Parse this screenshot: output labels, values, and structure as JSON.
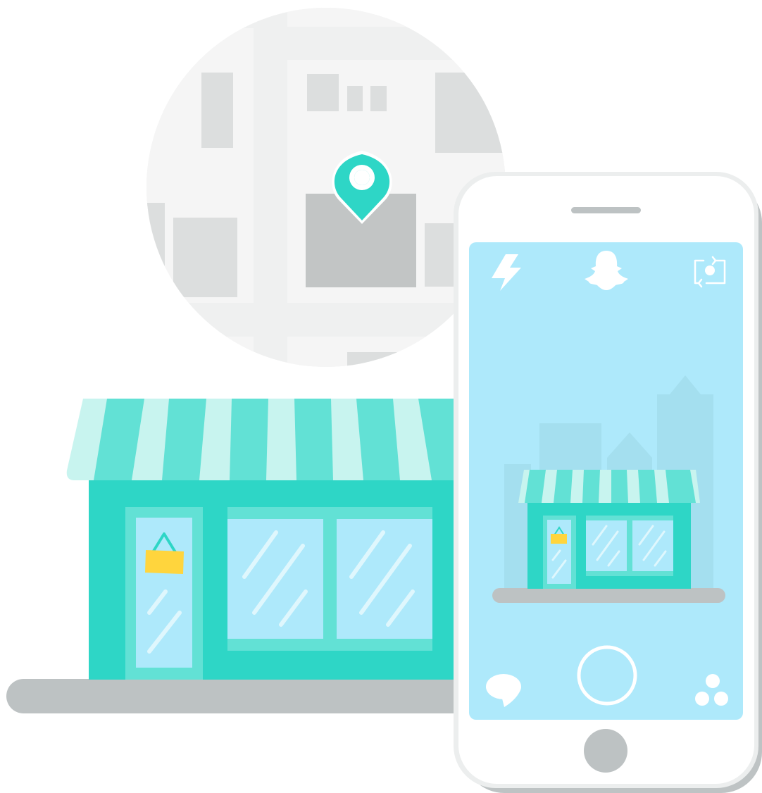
{
  "illustration": {
    "map": {
      "pin_icon": "location-pin-icon"
    },
    "storefront": {
      "awning_stripes": 11,
      "bag_icon": "shopping-bag-icon"
    },
    "phone": {
      "camera_ui": {
        "top_icons": [
          "flash-icon",
          "ghost-logo-icon",
          "camera-flip-icon"
        ],
        "bottom_icons": [
          "chat-icon",
          "capture-button",
          "memories-icon"
        ]
      }
    }
  },
  "colors": {
    "teal": "#2ed6c6",
    "teal_light": "#62e1d5",
    "mint": "#c8f4ef",
    "sky": "#aee9fb",
    "map_gray": "#dcdede",
    "street": "#bdc2c3",
    "phone_shadow": "#bec3c4",
    "bag_yellow": "#ffd53d"
  }
}
